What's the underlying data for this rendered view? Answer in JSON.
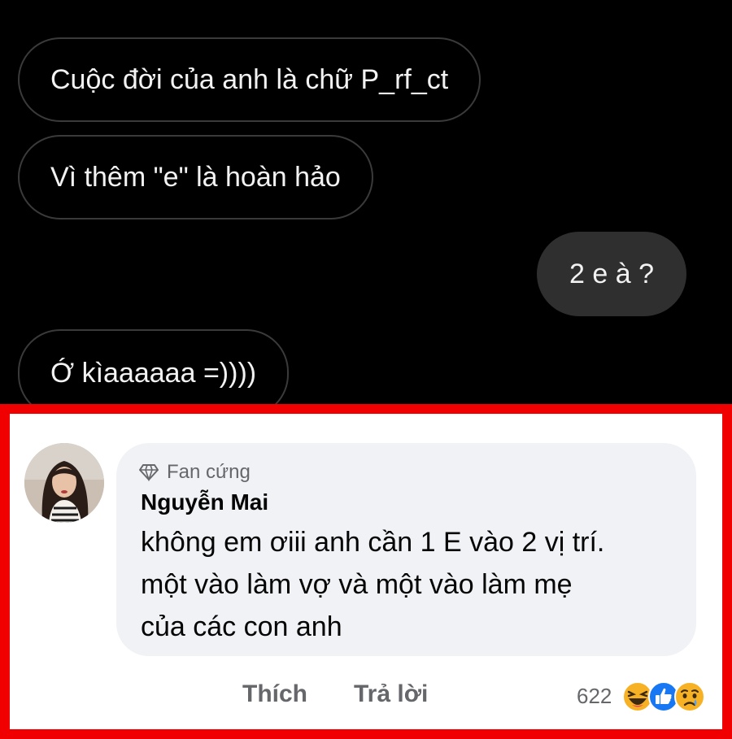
{
  "chat": {
    "messages": [
      {
        "side": "received",
        "text": "Cuộc đời của anh là chữ P_rf_ct"
      },
      {
        "side": "received",
        "text": "Vì thêm \"e\" là hoàn hảo"
      },
      {
        "side": "sent",
        "text": "2 e à ?"
      },
      {
        "side": "received",
        "text": "Ớ kìaaaaaa =))))"
      }
    ]
  },
  "comment": {
    "badge": {
      "icon": "diamond-icon",
      "label": "Fan cứng"
    },
    "author": "Nguyễn Mai",
    "text_lines": [
      "không em ơiii anh cần 1 E vào 2 vị trí.",
      "một vào làm vợ và một vào làm mẹ",
      "của các con anh"
    ],
    "actions": {
      "like": "Thích",
      "reply": "Trả lời"
    },
    "reactions": {
      "count": "622",
      "icons": [
        "haha-reaction-icon",
        "like-reaction-icon",
        "sad-reaction-icon"
      ]
    }
  },
  "colors": {
    "highlight_border": "#f00000",
    "chat_background": "#000000",
    "comment_bubble": "#f0f2f5"
  }
}
